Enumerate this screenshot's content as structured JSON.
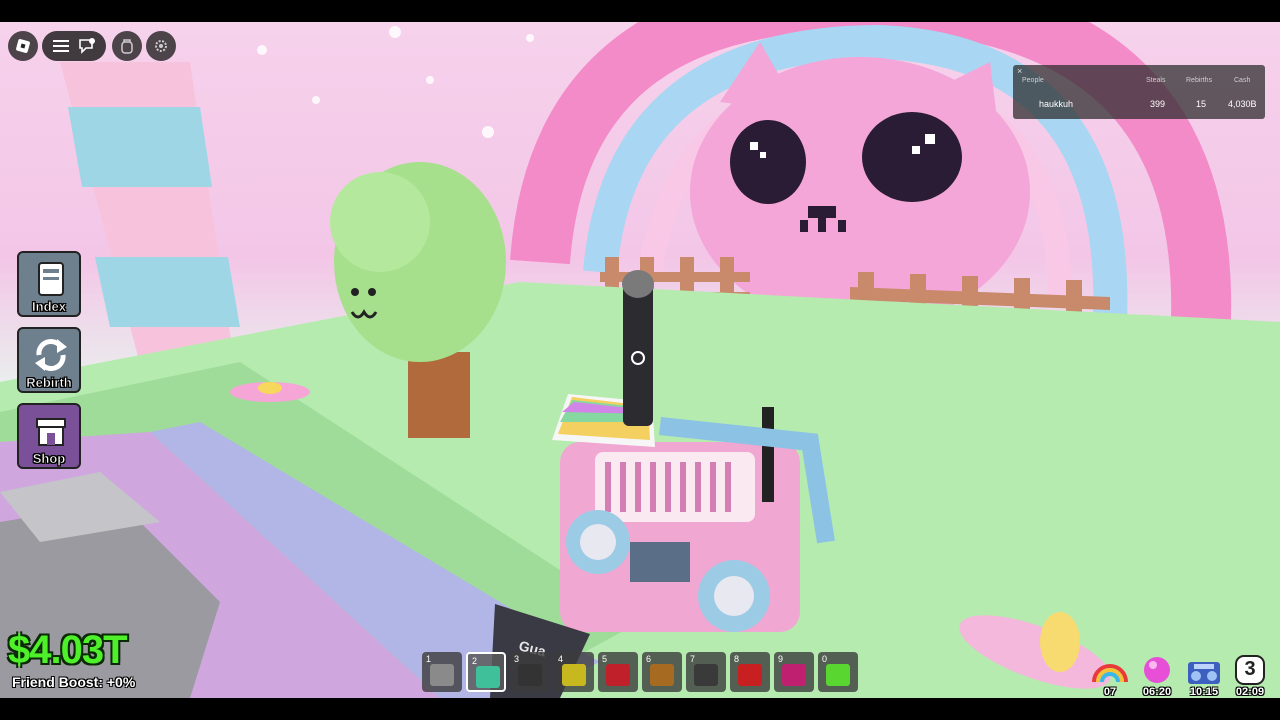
{
  "leaderboard": {
    "headers": [
      "People",
      "Steals",
      "Rebirths",
      "Cash"
    ],
    "rows": [
      {
        "name": "haukkuh",
        "steals": "399",
        "rebirths": "15",
        "cash": "4,030B"
      }
    ]
  },
  "side_menu": [
    {
      "label": "Index",
      "icon": "book-icon",
      "color": "#6e7f8e"
    },
    {
      "label": "Rebirth",
      "icon": "refresh-icon",
      "color": "#6e7f8e"
    },
    {
      "label": "Shop",
      "icon": "store-icon",
      "color": "#7a5098"
    }
  ],
  "stats": {
    "cash": "$4.03T",
    "friend_boost": "Friend Boost: +0%"
  },
  "hotbar": [
    {
      "num": "1",
      "item_color": "#8a8a8a"
    },
    {
      "num": "2",
      "item_color": "#3fbf9a"
    },
    {
      "num": "3",
      "item_color": "#333333"
    },
    {
      "num": "4",
      "item_color": "#c8b820"
    },
    {
      "num": "5",
      "item_color": "#c0202a"
    },
    {
      "num": "6",
      "item_color": "#a66a20"
    },
    {
      "num": "7",
      "item_color": "#3a3a3a"
    },
    {
      "num": "8",
      "item_color": "#c82020"
    },
    {
      "num": "9",
      "item_color": "#c02070"
    },
    {
      "num": "0",
      "item_color": "#5ad630"
    }
  ],
  "timers": [
    {
      "label": "07",
      "icon": "rainbow-icon"
    },
    {
      "label": "06:20",
      "icon": "pink-orb-icon"
    },
    {
      "label": "10:15",
      "icon": "boombox-icon"
    },
    {
      "label": "02:09",
      "icon": "clock-icon",
      "badge": "3"
    }
  ],
  "world": {
    "sign_text": "Gua"
  },
  "colors": {
    "cash_green": "#4ef02a",
    "sky_pink": "#f3c6e7",
    "grass_green": "#a8e5a3"
  }
}
